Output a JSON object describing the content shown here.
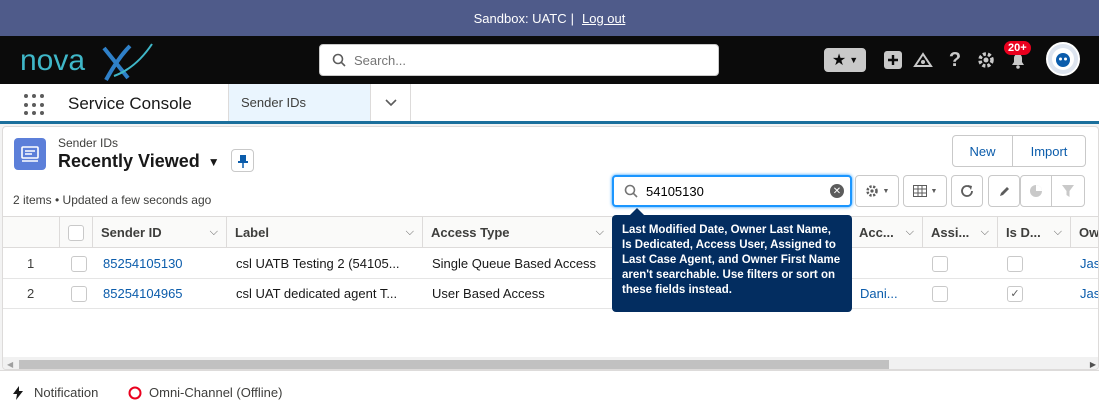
{
  "sandbox": {
    "text": "Sandbox: UATC",
    "separator": "|",
    "logout": "Log out"
  },
  "header": {
    "logo": "novaX",
    "search_placeholder": "Search...",
    "notification_count": "20+"
  },
  "nav": {
    "app_name": "Service Console",
    "tab_label": "Sender IDs"
  },
  "list": {
    "object_label": "Sender IDs",
    "view_name": "Recently Viewed",
    "meta": "2 items • Updated a few seconds ago",
    "new_label": "New",
    "import_label": "Import",
    "search_value": "54105130",
    "tooltip": "Last Modified Date, Owner Last Name, Is Dedicated, Access User, Assigned to Last Case Agent, and Owner First Name aren't searchable. Use filters or sort on these fields instead.",
    "columns": [
      "Sender ID",
      "Label",
      "Access Type",
      "Acc...",
      "Assi...",
      "Is D...",
      "Ow"
    ],
    "rows": [
      {
        "num": "1",
        "sender_id": "85254105130",
        "label": "csl UATB Testing 2 (54105...",
        "access_type": "Single Queue Based Access",
        "acc": "",
        "assigned": false,
        "dedicated": false,
        "owner": "Jas"
      },
      {
        "num": "2",
        "sender_id": "85254104965",
        "label": "csl UAT dedicated agent T...",
        "access_type": "User Based Access",
        "acc": "Dani...",
        "assigned": false,
        "dedicated": true,
        "owner": "Jas"
      }
    ]
  },
  "footer": {
    "notification": "Notification",
    "omni": "Omni-Channel (Offline)"
  },
  "colors": {
    "brand_bar": "#4f5b8a",
    "header": "#0b0b0b",
    "tooltip": "#032d60",
    "link": "#0b5cab",
    "accent": "#1b96ff"
  }
}
